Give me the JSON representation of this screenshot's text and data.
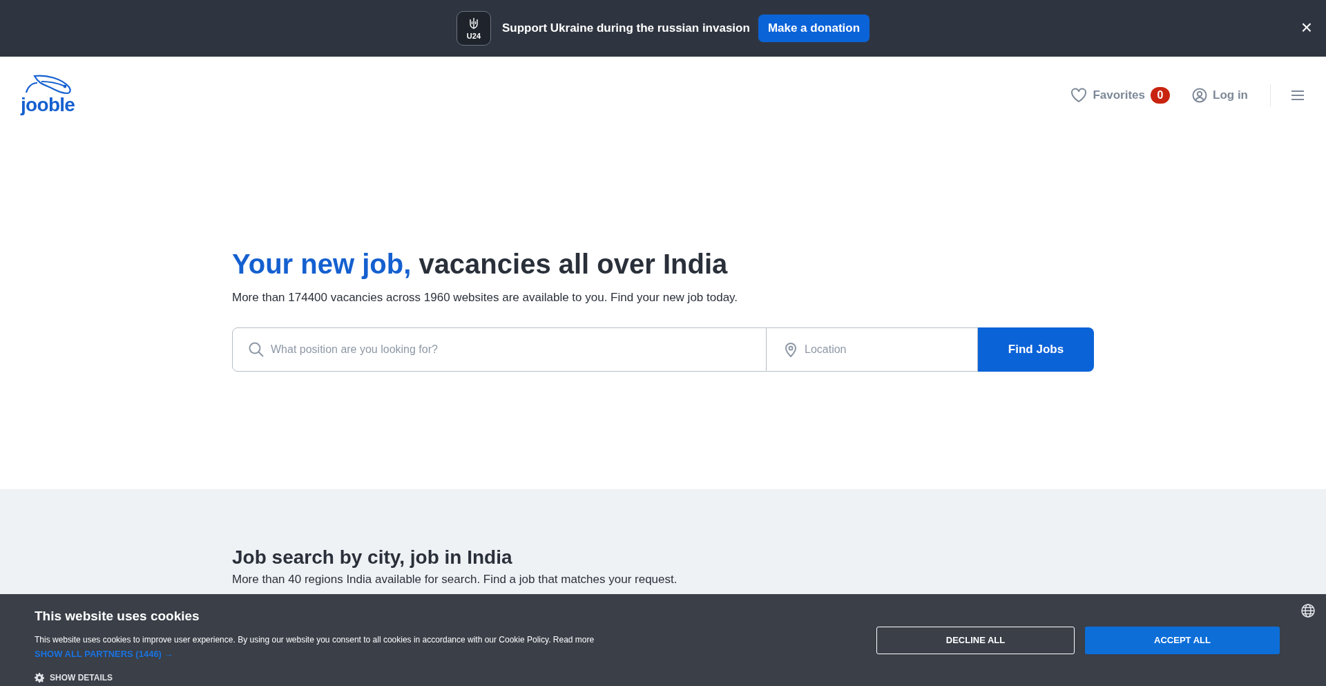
{
  "banner": {
    "badge": "U24",
    "message": "Support Ukraine during the russian invasion",
    "button": "Make a donation",
    "close": "×"
  },
  "header": {
    "logo": "jooble",
    "favorites": {
      "label": "Favorites",
      "count": "0"
    },
    "login": "Log in"
  },
  "hero": {
    "title_highlight": "Your new job,",
    "title_rest": "vacancies all over India",
    "subtitle": "More than 174400 vacancies across 1960 websites are available to you. Find your new job today.",
    "search": {
      "query_placeholder": "What position are you looking for?",
      "location_placeholder": "Location",
      "button": "Find Jobs"
    }
  },
  "cities": {
    "title": "Job search by city, job in India",
    "subtitle": "More than 40 regions India available for search. Find a job that matches your request."
  },
  "cookie_banner": {
    "title": "This website uses cookies",
    "text": "This website uses cookies to improve user experience. By using our website you consent to all cookies in accordance with our Cookie Policy.",
    "read_more": "Read more",
    "partners": "SHOW ALL PARTNERS (1446)",
    "partners_arrow": "→",
    "details": "SHOW DETAILS",
    "decline": "DECLINE ALL",
    "accept": "ACCEPT ALL"
  }
}
